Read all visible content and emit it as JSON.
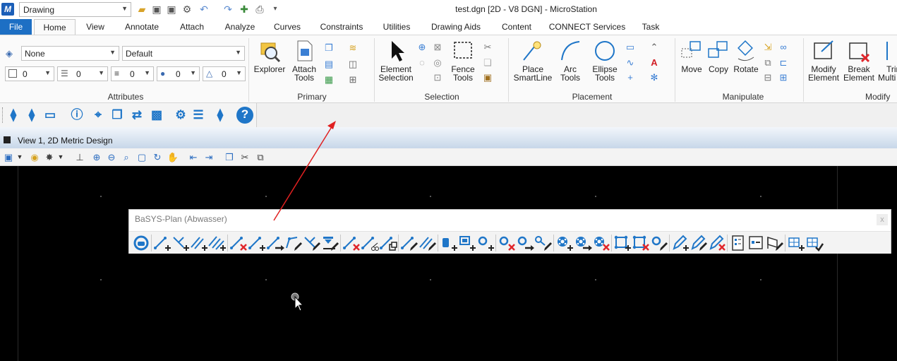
{
  "titlebar": {
    "app_logo": "M",
    "workflow_value": "Drawing",
    "window_title": "test.dgn [2D - V8 DGN] - MicroStation"
  },
  "tabs": [
    {
      "label": "File"
    },
    {
      "label": "Home"
    },
    {
      "label": "View"
    },
    {
      "label": "Annotate"
    },
    {
      "label": "Attach"
    },
    {
      "label": "Analyze"
    },
    {
      "label": "Curves"
    },
    {
      "label": "Constraints"
    },
    {
      "label": "Utilities"
    },
    {
      "label": "Drawing Aids"
    },
    {
      "label": "Content"
    },
    {
      "label": "CONNECT Services"
    },
    {
      "label": "Task"
    }
  ],
  "ribbon": {
    "attributes": {
      "level_value": "None",
      "style_value": "Default",
      "color_value": "0",
      "linestyle_value": "0",
      "weight_value": "0",
      "transparency_value": "0",
      "priority_value": "0",
      "label": "Attributes"
    },
    "primary": {
      "explorer": "Explorer",
      "attach_tools_1": "Attach",
      "attach_tools_2": "Tools",
      "label": "Primary"
    },
    "selection": {
      "element_selection_1": "Element",
      "element_selection_2": "Selection",
      "fence_tools_1": "Fence",
      "fence_tools_2": "Tools",
      "label": "Selection"
    },
    "placement": {
      "place_smartline_1": "Place",
      "place_smartline_2": "SmartLine",
      "arc_tools_1": "Arc",
      "arc_tools_2": "Tools",
      "ellipse_tools_1": "Ellipse",
      "ellipse_tools_2": "Tools",
      "label": "Placement"
    },
    "manipulate": {
      "move": "Move",
      "copy": "Copy",
      "rotate": "Rotate",
      "label": "Manipulate"
    },
    "modify": {
      "modify_element_1": "Modify",
      "modify_element_2": "Element",
      "break_element_1": "Break",
      "break_element_2": "Element",
      "trim_multi_1": "Trim",
      "trim_multi_2": "Multi",
      "label": "Modify"
    }
  },
  "view": {
    "title": "View 1, 2D Metric Design"
  },
  "basys": {
    "title": "BaSYS-Plan (Abwasser)",
    "close": "x"
  },
  "colors": {
    "accent": "#1d6fc4",
    "icon_blue": "#1f76c8",
    "delete_red": "#e0262b",
    "annotation_arrow": "#e02020"
  }
}
